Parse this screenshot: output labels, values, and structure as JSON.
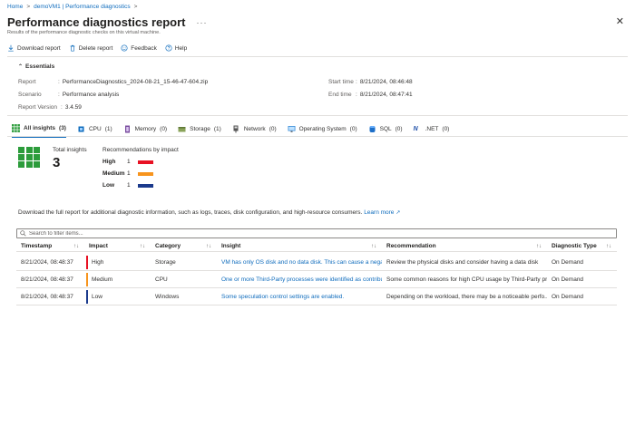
{
  "breadcrumb": {
    "home": "Home",
    "vm": "demoVM1 | Performance diagnostics"
  },
  "header": {
    "title": "Performance diagnostics report",
    "subtitle": "Results of the performance diagnostic checks on this virtual machine."
  },
  "toolbar": {
    "download": "Download report",
    "delete": "Delete report",
    "feedback": "Feedback",
    "help": "Help"
  },
  "essentials": {
    "heading": "Essentials",
    "report_label": "Report",
    "report_value": "PerformanceDiagnostics_2024-08-21_15-46-47-604.zip",
    "scenario_label": "Scenario",
    "scenario_value": "Performance analysis",
    "version_label": "Report Version",
    "version_value": "3.4.59",
    "start_label": "Start time",
    "start_value": "8/21/2024, 08:46:48",
    "end_label": "End time",
    "end_value": "8/21/2024, 08:47:41"
  },
  "tabs": [
    {
      "label": "All insights",
      "count": "(3)"
    },
    {
      "label": "CPU",
      "count": "(1)"
    },
    {
      "label": "Memory",
      "count": "(0)"
    },
    {
      "label": "Storage",
      "count": "(1)"
    },
    {
      "label": "Network",
      "count": "(0)"
    },
    {
      "label": "Operating System",
      "count": "(0)"
    },
    {
      "label": "SQL",
      "count": "(0)"
    },
    {
      "label": ".NET",
      "count": "(0)"
    }
  ],
  "summary": {
    "total_label": "Total insights",
    "total_value": "3",
    "rec_title": "Recommendations by impact",
    "impacts": [
      {
        "name": "High",
        "count": "1",
        "color": "#e81123"
      },
      {
        "name": "Medium",
        "count": "1",
        "color": "#f7941d"
      },
      {
        "name": "Low",
        "count": "1",
        "color": "#1b3a8c"
      }
    ]
  },
  "description": {
    "text": "Download the full report for additional diagnostic information, such as logs, traces, disk configuration, and high-resource consumers.",
    "link": "Learn more"
  },
  "filter": {
    "placeholder": "Search to filter items..."
  },
  "table": {
    "headers": [
      "Timestamp",
      "Impact",
      "Category",
      "Insight",
      "Recommendation",
      "Diagnostic Type"
    ],
    "rows": [
      {
        "timestamp": "8/21/2024, 08:48:37",
        "impact": "High",
        "impact_color": "#e81123",
        "category": "Storage",
        "insight": "VM has only OS disk and no data disk. This can cause a negativ",
        "recommendation": "Review the physical disks and consider having a data disk",
        "type": "On Demand"
      },
      {
        "timestamp": "8/21/2024, 08:48:37",
        "impact": "Medium",
        "impact_color": "#f7941d",
        "category": "CPU",
        "insight": "One or more Third-Party processes were identified as contribut",
        "recommendation": "Some common reasons for high CPU usage by Third-Party pr...",
        "type": "On Demand"
      },
      {
        "timestamp": "8/21/2024, 08:48:37",
        "impact": "Low",
        "impact_color": "#1b3a8c",
        "category": "Windows",
        "insight": "Some speculation control settings are enabled.",
        "recommendation": "Depending on the workload, there may be a noticeable perfo...",
        "type": "On Demand"
      }
    ]
  }
}
